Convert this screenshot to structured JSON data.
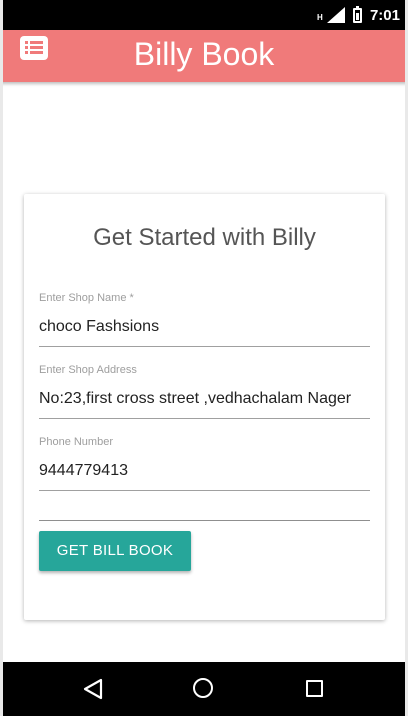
{
  "status_bar": {
    "time": "7:01",
    "network_type": "H",
    "icons": [
      "signal-icon",
      "battery-icon"
    ]
  },
  "app_bar": {
    "title": "Billy Book",
    "menu_icon": "list-icon"
  },
  "card": {
    "title": "Get Started with Billy",
    "fields": [
      {
        "label": "Enter Shop Name *",
        "value": "choco Fashsions"
      },
      {
        "label": "Enter Shop Address",
        "value": "No:23,first cross street ,vedhachalam Nager"
      },
      {
        "label": "Phone Number",
        "value": "9444779413"
      }
    ],
    "button_label": "GET BILL BOOK"
  },
  "nav_bar": {
    "icons": [
      "back-icon",
      "home-icon",
      "recents-icon"
    ]
  },
  "colors": {
    "app_bar": "#f07a7a",
    "button": "#26a69a",
    "status_bar": "#000000"
  }
}
